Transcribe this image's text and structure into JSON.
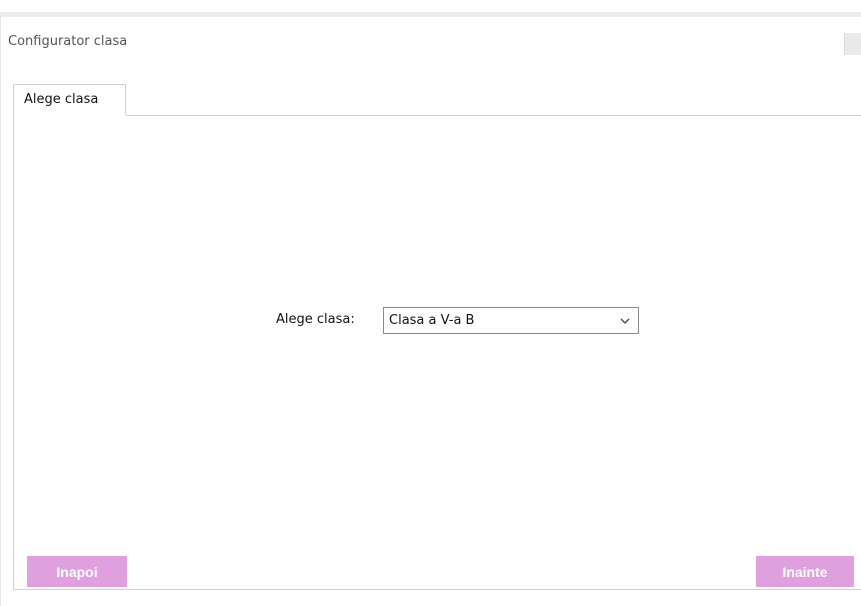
{
  "window": {
    "title": "Configurator clasa"
  },
  "tabs": [
    {
      "label": "Alege clasa",
      "selected": true
    }
  ],
  "form": {
    "class_label": "Alege clasa:",
    "class_select_value": "Clasa a V-a B"
  },
  "buttons": {
    "back_label": "Inapoi",
    "next_label": "Inainte"
  },
  "icons": {
    "dropdown": "chevron-down-icon"
  },
  "colors": {
    "button_bg": "#e0a0e0",
    "button_text": "#ffffff",
    "border": "#cfcfcf"
  }
}
